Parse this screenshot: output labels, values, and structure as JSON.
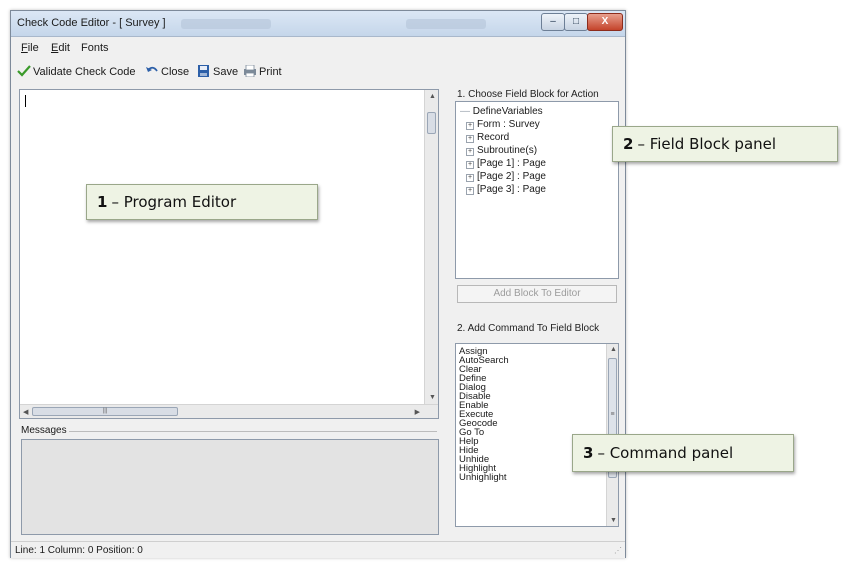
{
  "window": {
    "title": "Check Code Editor - [ Survey ]",
    "controls": {
      "minimize": "–",
      "maximize": "□",
      "close": "X"
    }
  },
  "menu": [
    {
      "label": "File",
      "underline": "F",
      "rest": "ile"
    },
    {
      "label": "Edit",
      "underline": "E",
      "rest": "dit"
    },
    {
      "label": "Fonts",
      "underline": "o"
    }
  ],
  "toolbar": {
    "validate": "Validate Check Code",
    "close": "Close",
    "save": "Save",
    "print": "Print"
  },
  "messages_label": "Messages",
  "field_block": {
    "label": "1. Choose Field Block for Action",
    "items": [
      {
        "label": "DefineVariables",
        "expander": false
      },
      {
        "label": "Form : Survey",
        "expander": true
      },
      {
        "label": "Record",
        "expander": true
      },
      {
        "label": "Subroutine(s)",
        "expander": true
      },
      {
        "label": "[Page 1] : Page",
        "expander": true
      },
      {
        "label": "[Page 2] : Page",
        "expander": true
      },
      {
        "label": "[Page 3] : Page",
        "expander": true
      }
    ],
    "add_button": "Add Block To Editor"
  },
  "command_panel": {
    "label": "2. Add Command To Field Block",
    "items": [
      "Assign",
      "AutoSearch",
      "Clear",
      "Define",
      "Dialog",
      "Disable",
      "Enable",
      "Execute",
      "Geocode",
      "Go To",
      "Help",
      "Hide",
      "Unhide",
      "Highlight",
      "Unhighlight"
    ]
  },
  "status": "Line: 1  Column: 0  Position: 0",
  "callouts": [
    {
      "number": "1",
      "text": "– Program Editor"
    },
    {
      "number": "2",
      "text": "– Field Block panel"
    },
    {
      "number": "3",
      "text": "– Command panel"
    }
  ],
  "colors": {
    "titlebar": "#c5d6ea",
    "close_button": "#c4432b",
    "callout_bg": "#eef3e4",
    "window_bg": "#f0f0f0"
  }
}
